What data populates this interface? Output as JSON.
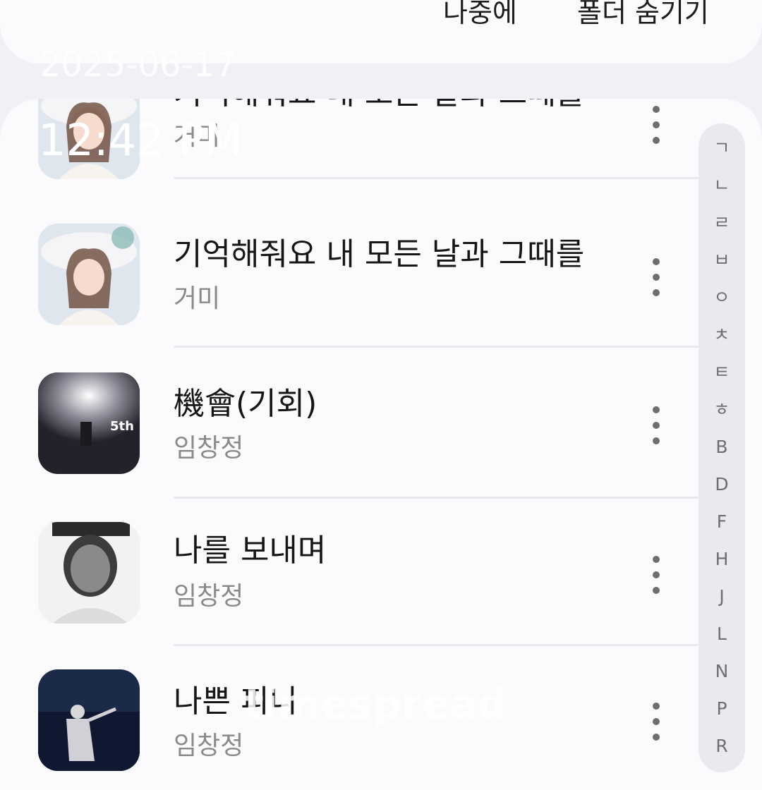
{
  "top_bar": {
    "later_label": "나중에",
    "hide_folder_label": "폴더 숨기기"
  },
  "overlay": {
    "date": "2025-06-17",
    "time": "12:42 PM",
    "watermark": "timespread"
  },
  "songs": [
    {
      "title": "기억해줘요 내 모든 날과 그때를",
      "artist": "거미",
      "art_icon": "album-art-gummy"
    },
    {
      "title": "기억해줘요 내 모든 날과 그때를",
      "artist": "거미",
      "art_icon": "album-art-gummy"
    },
    {
      "title": "機會(기회)",
      "artist": "임창정",
      "art_icon": "album-art-lim-5th"
    },
    {
      "title": "나를 보내며",
      "artist": "임창정",
      "art_icon": "album-art-lim-portrait"
    },
    {
      "title": "나쁜 피니",
      "artist": "임창정",
      "art_icon": "album-art-lim-stage"
    }
  ],
  "index_letters": [
    "ㄱ",
    "ㄴ",
    "ㄹ",
    "ㅂ",
    "ㅇ",
    "ㅊ",
    "ㅌ",
    "ㅎ",
    "B",
    "D",
    "F",
    "H",
    "J",
    "L",
    "N",
    "P",
    "R"
  ],
  "album_5th_text": "5th",
  "colors": {
    "background": "#f1f0f5",
    "card": "#fbfbfe",
    "title": "#161616",
    "artist": "#8a8a8a",
    "index_bar": "#e9e9ee"
  }
}
